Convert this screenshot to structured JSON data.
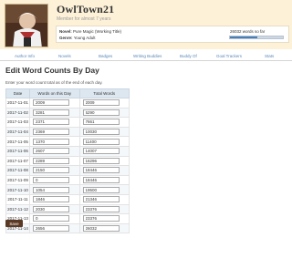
{
  "profile": {
    "username": "OwlTown21",
    "member_since": "Member for almost 7 years",
    "novel_label": "Novel:",
    "novel_title": "Pure Magic (Working Title)",
    "genre_label": "Genre:",
    "genre": "Young Adult",
    "word_count_text": "26032 words so far",
    "progress_fraction": 0.52
  },
  "nav": {
    "tabs": [
      "Author Info",
      "Novels",
      "Badges",
      "Writing Buddies",
      "Buddy Of",
      "Goal Trackers",
      "Stats"
    ]
  },
  "page": {
    "title": "Edit Word Counts By Day",
    "instructions": "Enter your word count total as of the end of each day."
  },
  "table": {
    "headers": [
      "Date",
      "Words on this Day",
      "Total Words"
    ],
    "rows": [
      {
        "date": "2017-11-01",
        "words": "2009",
        "total": "2009"
      },
      {
        "date": "2017-11-02",
        "words": "3281",
        "total": "5290"
      },
      {
        "date": "2017-11-03",
        "words": "2371",
        "total": "7661"
      },
      {
        "date": "2017-11-04",
        "words": "2369",
        "total": "10030"
      },
      {
        "date": "2017-11-05",
        "words": "1370",
        "total": "11400"
      },
      {
        "date": "2017-11-06",
        "words": "2607",
        "total": "14007"
      },
      {
        "date": "2017-11-07",
        "words": "2289",
        "total": "16296"
      },
      {
        "date": "2017-11-08",
        "words": "2150",
        "total": "18446"
      },
      {
        "date": "2017-11-09",
        "words": "0",
        "total": "18446"
      },
      {
        "date": "2017-11-10",
        "words": "1054",
        "total": "19500"
      },
      {
        "date": "2017-11-11",
        "words": "1846",
        "total": "21346"
      },
      {
        "date": "2017-11-12",
        "words": "2030",
        "total": "23376"
      },
      {
        "date": "2017-11-13",
        "words": "0",
        "total": "23376"
      },
      {
        "date": "2017-11-14",
        "words": "2656",
        "total": "26032"
      }
    ]
  },
  "actions": {
    "save_label": "Save"
  }
}
